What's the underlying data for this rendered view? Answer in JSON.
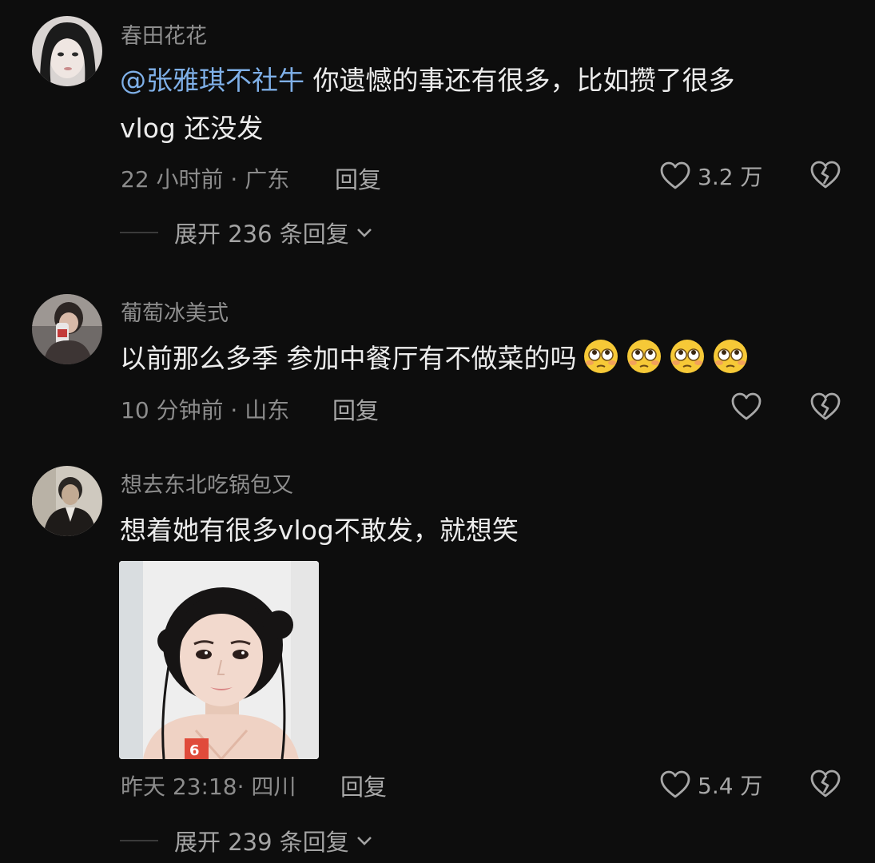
{
  "comments": [
    {
      "username": "春田花花",
      "mention": "@张雅琪不社牛",
      "text_line1": "你遗憾的事还有很多，比如攒了很多",
      "text_line2": "vlog 还没发",
      "meta": "22 小时前 · 广东",
      "reply_label": "回复",
      "likes": "3.2 万",
      "expand_label": "展开 236 条回复"
    },
    {
      "username": "葡萄冰美式",
      "text": "以前那么多季 参加中餐厅有不做菜的吗",
      "emoji_count": 4,
      "emoji_name": "flushed-face-emoji",
      "meta": "10 分钟前 · 山东",
      "reply_label": "回复"
    },
    {
      "username": "想去东北吃锅包又",
      "text": "想着她有很多vlog不敢发，就想笑",
      "has_image": true,
      "meta": "昨天 23:18· 四川",
      "reply_label": "回复",
      "likes": "5.4 万",
      "expand_label": "展开 239 条回复"
    }
  ],
  "colors": {
    "background": "#0d0d0d",
    "mention": "#7fb0e8",
    "secondary_text": "#8e8e8e"
  }
}
